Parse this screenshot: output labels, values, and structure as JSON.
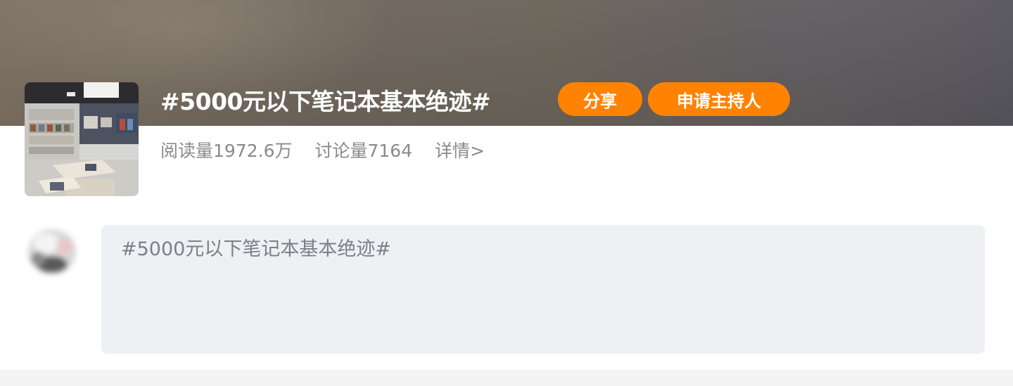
{
  "topic": {
    "title": "#5000元以下笔记本基本绝迹#",
    "share_label": "分享",
    "apply_host_label": "申请主持人",
    "reads": "阅读量1972.6万",
    "discussions": "讨论量7164",
    "details": "详情>"
  },
  "composer": {
    "text": "#5000元以下笔记本基本绝迹#"
  },
  "colors": {
    "accent": "#ff8200",
    "composer_bg": "#eef0f4",
    "meta_text": "#8a8a8a"
  }
}
